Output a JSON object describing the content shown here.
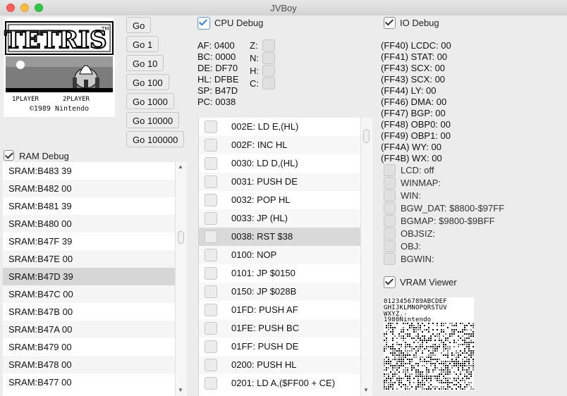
{
  "window": {
    "title": "JVBoy"
  },
  "game_screen": {
    "logo": "TETRIS",
    "tm": "TM",
    "player1": "1PLAYER",
    "player2": "2PLAYER",
    "copyright": "©1989 Nintendo"
  },
  "go_buttons": [
    "Go",
    "Go 1",
    "Go 10",
    "Go 100",
    "Go 1000",
    "Go 10000",
    "Go 100000"
  ],
  "cpu_debug": {
    "label": "CPU Debug",
    "checked": true,
    "registers": [
      "AF: 0400",
      "BC: 0000",
      "DE: DF70",
      "HL: DFBE",
      "SP: B47D",
      "PC: 0038"
    ],
    "flags": [
      "Z:",
      "N:",
      "H:",
      "C:"
    ]
  },
  "code_list": [
    "002E: LD E,(HL)",
    "002F: INC HL",
    "0030: LD D,(HL)",
    "0031: PUSH DE",
    "0032: POP HL",
    "0033: JP (HL)",
    "0038: RST $38",
    "0100: NOP",
    "0101: JP $0150",
    "0150: JP $028B",
    "01FD: PUSH AF",
    "01FE: PUSH BC",
    "01FF: PUSH DE",
    "0200: PUSH HL",
    "0201: LD A,($FF00 + CE)"
  ],
  "code_selected_index": 6,
  "ram_debug": {
    "label": "RAM Debug",
    "checked": true,
    "rows": [
      "SRAM:B483  39",
      "SRAM:B482  00",
      "SRAM:B481  39",
      "SRAM:B480  00",
      "SRAM:B47F  39",
      "SRAM:B47E  00",
      "SRAM:B47D  39",
      "SRAM:B47C  00",
      "SRAM:B47B  00",
      "SRAM:B47A  00",
      "SRAM:B479  00",
      "SRAM:B478  00",
      "SRAM:B477  00"
    ],
    "selected_index": 6
  },
  "io_debug": {
    "label": "IO Debug",
    "checked": true,
    "registers": [
      "(FF40) LCDC: 00",
      "(FF41) STAT: 00",
      "(FF43) SCX: 00",
      "(FF43) SCX: 00",
      "(FF44) LY: 00",
      "(FF46) DMA: 00",
      "(FF47) BGP: 00",
      "(FF48) OBP0: 00",
      "(FF49) OBP1: 00",
      "(FF4A) WY: 00",
      "(FF4B) WX: 00"
    ],
    "lcdc_bits": [
      "LCD: off",
      "WINMAP:",
      "WIN:",
      "BGW_DAT: $8800-$97FF",
      "BGMAP: $9800-$9BFF",
      "OBJSIZ:",
      "OBJ:",
      "BGWIN:"
    ]
  },
  "vram_viewer": {
    "label": "VRAM Viewer",
    "checked": true,
    "line1": "0123456789ABCDEF",
    "line2": "GHIJKLMNOPQRSTUV",
    "line3": "WXYZ.-",
    "line4": "1980Nintendo"
  }
}
